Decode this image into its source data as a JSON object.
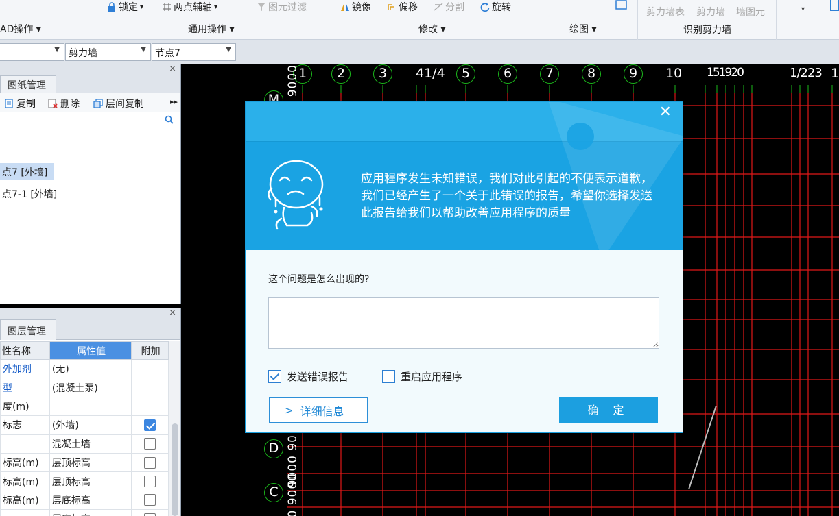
{
  "ribbon": {
    "lock_label": "锁定",
    "two_point_axis_label": "两点辅轴",
    "element_filter_label": "图元过滤",
    "mirror_label": "镜像",
    "offset_label": "偏移",
    "split_label": "分割",
    "rotate_label": "旋转",
    "recognize_items": [
      "剪力墙表",
      "剪力墙",
      "墙图元"
    ],
    "groups": {
      "cad_ops": "AD操作 ▾",
      "general_ops": "通用操作 ▾",
      "modify": "修改 ▾",
      "draw": "绘图 ▾",
      "recognize_shear_wall": "识别剪力墙"
    }
  },
  "selectors": {
    "floor": "",
    "type": "剪力墙",
    "element": "节点7"
  },
  "drawing_panel": {
    "tab_label": "图纸管理",
    "toolbar": {
      "copy": "复制",
      "delete": "删除",
      "floor_copy": "层间复制"
    },
    "items": [
      "点7 [外墙]",
      "点7-1 [外墙]"
    ]
  },
  "layer_panel": {
    "tab_label": "图层管理",
    "headers": [
      "性名称",
      "属性值",
      "附加"
    ],
    "rows": [
      {
        "name": "外加剂",
        "value": "(无)",
        "link": true,
        "checkbox": null
      },
      {
        "name": "型",
        "value": "(混凝土泵)",
        "link": true,
        "checkbox": null
      },
      {
        "name": "度(m)",
        "value": "",
        "link": false,
        "checkbox": null
      },
      {
        "name": "标志",
        "value": "(外墙)",
        "link": false,
        "checkbox": true
      },
      {
        "name": "",
        "value": "混凝土墙",
        "link": false,
        "checkbox": false
      },
      {
        "name": "标高(m)",
        "value": "层顶标高",
        "link": false,
        "checkbox": false
      },
      {
        "name": "标高(m)",
        "value": "层顶标高",
        "link": false,
        "checkbox": false
      },
      {
        "name": "标高(m)",
        "value": "层底标高",
        "link": false,
        "checkbox": false
      },
      {
        "name": "",
        "value": "层底标高",
        "link": false,
        "checkbox": false
      }
    ]
  },
  "canvas": {
    "axis_labels": [
      "1",
      "2",
      "3",
      "41/4",
      "5",
      "6",
      "7",
      "8",
      "9",
      "10",
      "151920",
      "1/223",
      "1"
    ],
    "row_labels": [
      "M",
      "D",
      "C"
    ],
    "dim_texts": [
      "9000",
      "9000 90",
      "00 9000"
    ]
  },
  "dialog": {
    "close_glyph": "✕",
    "message": "应用程序发生未知错误，我们对此引起的不便表示道歉，我们已经产生了一个关于此错误的报告，希望你选择发送此报告给我们以帮助改善应用程序的质量",
    "question": "这个问题是怎么出现的?",
    "input_value": "",
    "send_report_label": "发送错误报告",
    "send_report_checked": true,
    "restart_label": "重启应用程序",
    "restart_checked": false,
    "details_label": "详细信息",
    "ok_label": "确 定"
  }
}
